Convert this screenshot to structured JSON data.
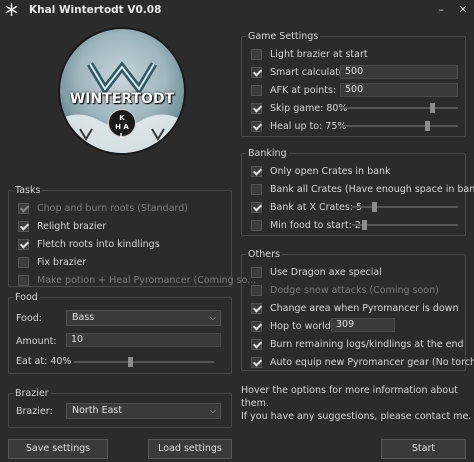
{
  "window": {
    "title": "Khal Wintertodt V0.08",
    "icons": {
      "app": "snowflake-icon",
      "minimize": "minimize-icon",
      "close": "close-icon"
    }
  },
  "logo": {
    "text": "WINTERTODT",
    "badge": "K\nH A\nL"
  },
  "tasks": {
    "legend": "Tasks",
    "items": [
      {
        "label": "Chop and burn roots (Standard)",
        "checked": true,
        "disabled": true
      },
      {
        "label": "Relight brazier",
        "checked": true,
        "disabled": false
      },
      {
        "label": "Fletch roots into kindlings",
        "checked": true,
        "disabled": false
      },
      {
        "label": "Fix brazier",
        "checked": false,
        "disabled": false
      },
      {
        "label": "Make potion + Heal Pyromancer (Coming so...",
        "checked": false,
        "disabled": true
      }
    ]
  },
  "food": {
    "legend": "Food",
    "food_label": "Food:",
    "food_value": "Bass",
    "amount_label": "Amount:",
    "amount_value": "10",
    "eat_at_label": "Eat at: 40%",
    "eat_at_percent": 40
  },
  "brazier": {
    "legend": "Brazier",
    "label": "Brazier:",
    "value": "North East"
  },
  "game_settings": {
    "legend": "Game Settings",
    "items": [
      {
        "label": "Light brazier at start",
        "checked": false
      },
      {
        "label": "Smart calculate:",
        "checked": true,
        "value": "500"
      },
      {
        "label": "AFK at points:",
        "checked": false,
        "value": "500"
      },
      {
        "label": "Skip game: 80%",
        "checked": true,
        "slider": 80
      },
      {
        "label": "Heal up to: 75%",
        "checked": true,
        "slider": 75
      }
    ]
  },
  "banking": {
    "legend": "Banking",
    "items": [
      {
        "label": "Only open Crates in bank",
        "checked": true
      },
      {
        "label": "Bank all Crates (Have enough space in bank)",
        "checked": false
      },
      {
        "label": "Bank at X Crates: 5",
        "checked": true,
        "slider": 20
      },
      {
        "label": "Min food to start: 2",
        "checked": false,
        "slider": 10
      }
    ]
  },
  "others": {
    "legend": "Others",
    "items": [
      {
        "label": "Use Dragon axe special",
        "checked": false,
        "disabled": false
      },
      {
        "label": "Dodge snow attacks (Coming soon)",
        "checked": false,
        "disabled": true
      },
      {
        "label": "Change area when Pyromancer is down",
        "checked": true,
        "disabled": false
      },
      {
        "label": "Hop to world",
        "checked": true,
        "disabled": false,
        "value": "309"
      },
      {
        "label": "Burn remaining logs/kindlings at the end",
        "checked": true,
        "disabled": false
      },
      {
        "label": "Auto equip new Pyromancer gear (No torch)",
        "checked": true,
        "disabled": false
      }
    ]
  },
  "help": {
    "line1": "Hover the options for more information about them.",
    "line2": "If you have any suggestions, please contact me."
  },
  "buttons": {
    "save": "Save settings",
    "load": "Load settings",
    "start": "Start"
  }
}
